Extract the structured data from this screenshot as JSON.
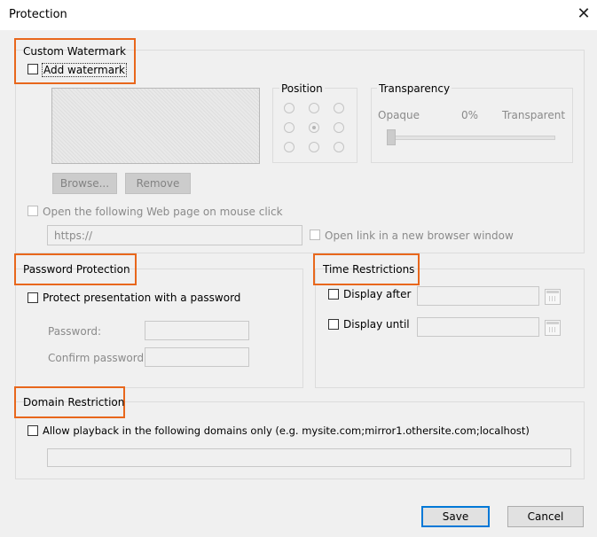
{
  "dialog": {
    "title": "Protection",
    "close_icon": "close-icon"
  },
  "watermark": {
    "group_label": "Custom Watermark",
    "add_label": "Add watermark",
    "position_label": "Position",
    "transparency_label": "Transparency",
    "opaque_label": "Opaque",
    "transparency_value": "0%",
    "transparent_label": "Transparent",
    "browse_label": "Browse...",
    "remove_label": "Remove",
    "open_webpage_label": "Open the following Web page on mouse click",
    "url_value": "https://",
    "new_window_label": "Open link in a new browser window"
  },
  "password": {
    "group_label": "Password Protection",
    "protect_label": "Protect presentation with a password",
    "password_label": "Password:",
    "confirm_label": "Confirm password:"
  },
  "time": {
    "group_label": "Time Restrictions",
    "display_after_label": "Display after",
    "display_until_label": "Display until",
    "calendar_icon": "calendar-icon"
  },
  "domain": {
    "group_label": "Domain Restriction",
    "allow_label": "Allow playback in the following domains only (e.g. mysite.com;mirror1.othersite.com;localhost)"
  },
  "footer": {
    "save_label": "Save",
    "cancel_label": "Cancel"
  },
  "colors": {
    "highlight": "#e8671c",
    "dialog_bg": "#f0f0f0",
    "titlebar_bg": "#ffffff",
    "primary_button_border": "#0078d7"
  }
}
